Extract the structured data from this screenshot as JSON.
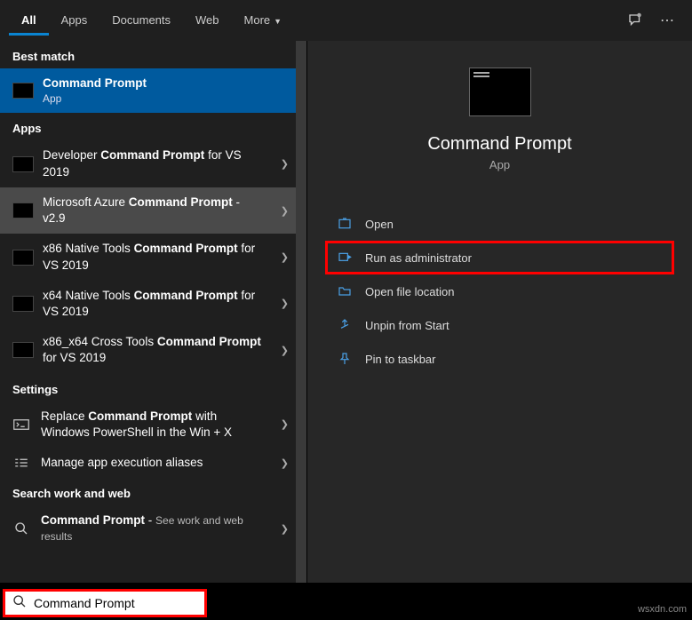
{
  "tabs": {
    "items": [
      "All",
      "Apps",
      "Documents",
      "Web",
      "More"
    ],
    "active": "All"
  },
  "groups": {
    "best_match": "Best match",
    "apps": "Apps",
    "settings": "Settings",
    "search_web": "Search work and web"
  },
  "best_match_item": {
    "title": "Command Prompt",
    "sub": "App"
  },
  "app_items": [
    {
      "pre": "Developer ",
      "bold": "Command Prompt",
      "post": " for VS 2019"
    },
    {
      "pre": "Microsoft Azure ",
      "bold": "Command Prompt",
      "post": " - v2.9"
    },
    {
      "pre": "x86 Native Tools ",
      "bold": "Command Prompt",
      "post": " for VS 2019"
    },
    {
      "pre": "x64 Native Tools ",
      "bold": "Command Prompt",
      "post": " for VS 2019"
    },
    {
      "pre": "x86_x64 Cross Tools ",
      "bold": "Command",
      "post2_bold": "Prompt",
      "post": " for VS 2019"
    }
  ],
  "settings_items": [
    {
      "pre": "Replace ",
      "bold": "Command Prompt",
      "post": " with Windows PowerShell in the Win + X"
    },
    {
      "text": "Manage app execution aliases"
    }
  ],
  "web_items": [
    {
      "bold": "Command Prompt",
      "post": " - ",
      "hint": "See work and web results"
    }
  ],
  "preview": {
    "title": "Command Prompt",
    "sub": "App"
  },
  "actions": [
    {
      "icon": "open",
      "label": "Open"
    },
    {
      "icon": "admin",
      "label": "Run as administrator",
      "highlight": true
    },
    {
      "icon": "folder",
      "label": "Open file location"
    },
    {
      "icon": "unpin",
      "label": "Unpin from Start"
    },
    {
      "icon": "pin",
      "label": "Pin to taskbar"
    }
  ],
  "search": {
    "value": "Command Prompt"
  },
  "watermark": "wsxdn.com"
}
